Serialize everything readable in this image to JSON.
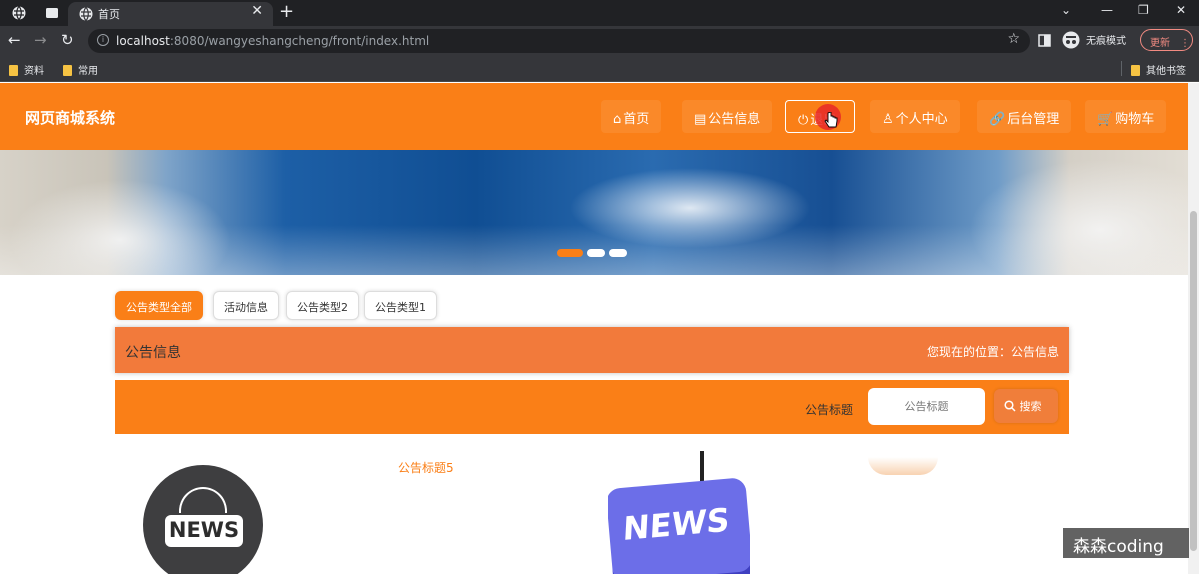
{
  "browser": {
    "tab_title": "首页",
    "url_host": "localhost",
    "url_rest": ":8080/wangyeshangcheng/front/index.html",
    "incognito_label": "无痕模式",
    "update_label": "更新",
    "bookmarks": [
      "资料",
      "常用"
    ],
    "other_bookmarks": "其他书签"
  },
  "site": {
    "title": "网页商城系统",
    "nav": [
      {
        "icon": "⌂",
        "label": "首页"
      },
      {
        "icon": "▤",
        "label": "公告信息"
      },
      {
        "icon": "⏻",
        "label": "退出"
      },
      {
        "icon": "♙",
        "label": "个人中心"
      },
      {
        "icon": "🔗",
        "label": "后台管理"
      },
      {
        "icon": "🛒",
        "label": "购物车"
      }
    ]
  },
  "carousel": {
    "active_index": 0,
    "count": 3
  },
  "categories": [
    "公告类型全部",
    "活动信息",
    "公告类型2",
    "公告类型1"
  ],
  "notice": {
    "title": "公告信息",
    "breadcrumb": "您现在的位置：公告信息"
  },
  "search": {
    "label": "公告标题",
    "placeholder": "公告标题",
    "button": "搜索"
  },
  "news": {
    "item_title": "公告标题5",
    "image1_text": "NEWS",
    "image2_text": "NEWS"
  },
  "watermark": "森森coding",
  "colors": {
    "primary": "#fa7f17",
    "info_bar": "#f27a3b"
  }
}
